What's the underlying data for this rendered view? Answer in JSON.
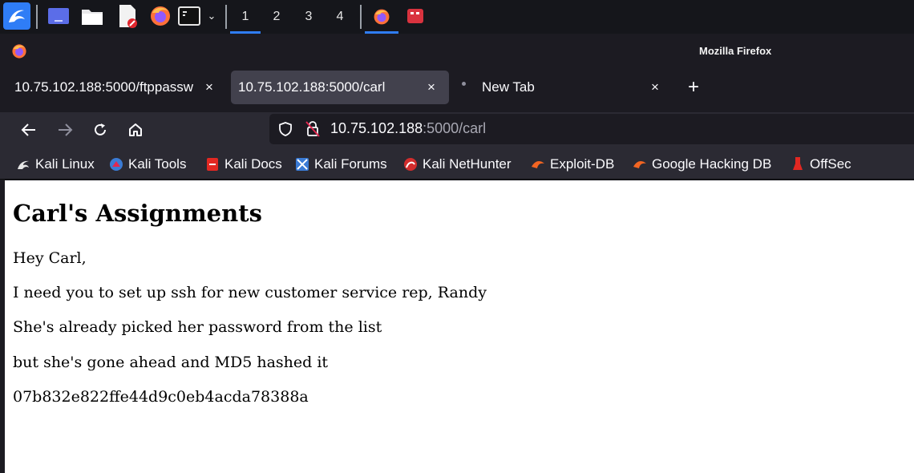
{
  "taskbar": {
    "workspaces": [
      "1",
      "2",
      "3",
      "4"
    ],
    "active_workspace": "1"
  },
  "window": {
    "title": "Mozilla Firefox"
  },
  "tabs": [
    {
      "label": "10.75.102.188:5000/ftppassw",
      "selected": false
    },
    {
      "label": "10.75.102.188:5000/carl",
      "selected": true
    },
    {
      "label": "New Tab",
      "selected": false
    }
  ],
  "tab_close_glyph": "×",
  "new_tab_glyph": "+",
  "urlbar": {
    "host": "10.75.102.188",
    "rest": ":5000/carl"
  },
  "bookmarks": [
    {
      "label": "Kali Linux",
      "icon": "kali-dragon-icon"
    },
    {
      "label": "Kali Tools",
      "icon": "kali-tools-icon"
    },
    {
      "label": "Kali Docs",
      "icon": "kali-docs-icon"
    },
    {
      "label": "Kali Forums",
      "icon": "kali-forums-icon"
    },
    {
      "label": "Kali NetHunter",
      "icon": "nethunter-icon"
    },
    {
      "label": "Exploit-DB",
      "icon": "exploit-db-icon"
    },
    {
      "label": "Google Hacking DB",
      "icon": "ghdb-icon"
    },
    {
      "label": "OffSec",
      "icon": "offsec-icon"
    }
  ],
  "page": {
    "heading": "Carl's Assignments",
    "lines": [
      "Hey Carl,",
      "I need you to set up ssh for new customer service rep, Randy",
      "She's already picked her password from the list",
      "but she's gone ahead and MD5 hashed it",
      "07b832e822ffe44d9c0eb4acda78388a"
    ]
  },
  "colors": {
    "accent": "#2f7df6",
    "toolbar": "#2b2a33",
    "frame": "#1c1b22",
    "selected_tab": "#42414d"
  }
}
